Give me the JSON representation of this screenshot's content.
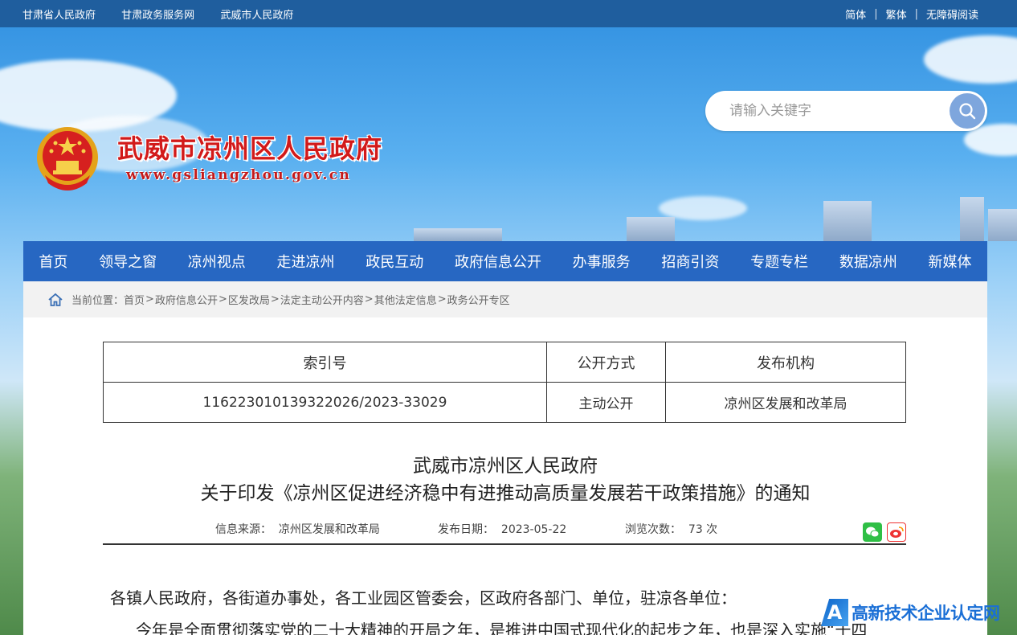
{
  "topbar": {
    "links": [
      "甘肃省人民政府",
      "甘肃政务服务网",
      "武威市人民政府"
    ],
    "lang": [
      "简体",
      "繁体",
      "无障碍阅读"
    ]
  },
  "header": {
    "title": "武威市凉州区人民政府",
    "url": "www.gsliangzhou.gov.cn"
  },
  "search": {
    "placeholder": "请输入关键字",
    "icon": "search-icon"
  },
  "nav": [
    "首页",
    "领导之窗",
    "凉州视点",
    "走进凉州",
    "政民互动",
    "政府信息公开",
    "办事服务",
    "招商引资",
    "专题专栏",
    "数据凉州",
    "新媒体"
  ],
  "breadcrumb": {
    "prefix": "当前位置：",
    "items": [
      "首页",
      "政府信息公开",
      "区发改局",
      "法定主动公开内容",
      "其他法定信息",
      "政务公开专区"
    ]
  },
  "meta_table": {
    "headers": [
      "索引号",
      "公开方式",
      "发布机构"
    ],
    "values": [
      "116223010139322026/2023-33029",
      "主动公开",
      "凉州区发展和改革局"
    ]
  },
  "article": {
    "title_line1": "武威市凉州区人民政府",
    "title_line2": "关于印发《凉州区促进经济稳中有进推动高质量发展若干政策措施》的通知",
    "source_label": "信息来源：",
    "source": "凉州区发展和改革局",
    "date_label": "发布日期：",
    "date": "2023-05-22",
    "views_label": "浏览次数：",
    "views": "73 次",
    "para1": "各镇人民政府，各街道办事处，各工业园区管委会，区政府各部门、单位，驻凉各单位：",
    "para2": "今年是全面贯彻落实党的二十大精神的开局之年，是推进中国式现代化的起步之年，也是深入实施“十四"
  },
  "watermark": {
    "mark": "A",
    "text": "高新技术企业认定网"
  },
  "colors": {
    "topbar": "#1f5e9e",
    "nav": "#2767c2",
    "title_red": "#d21a1a"
  }
}
